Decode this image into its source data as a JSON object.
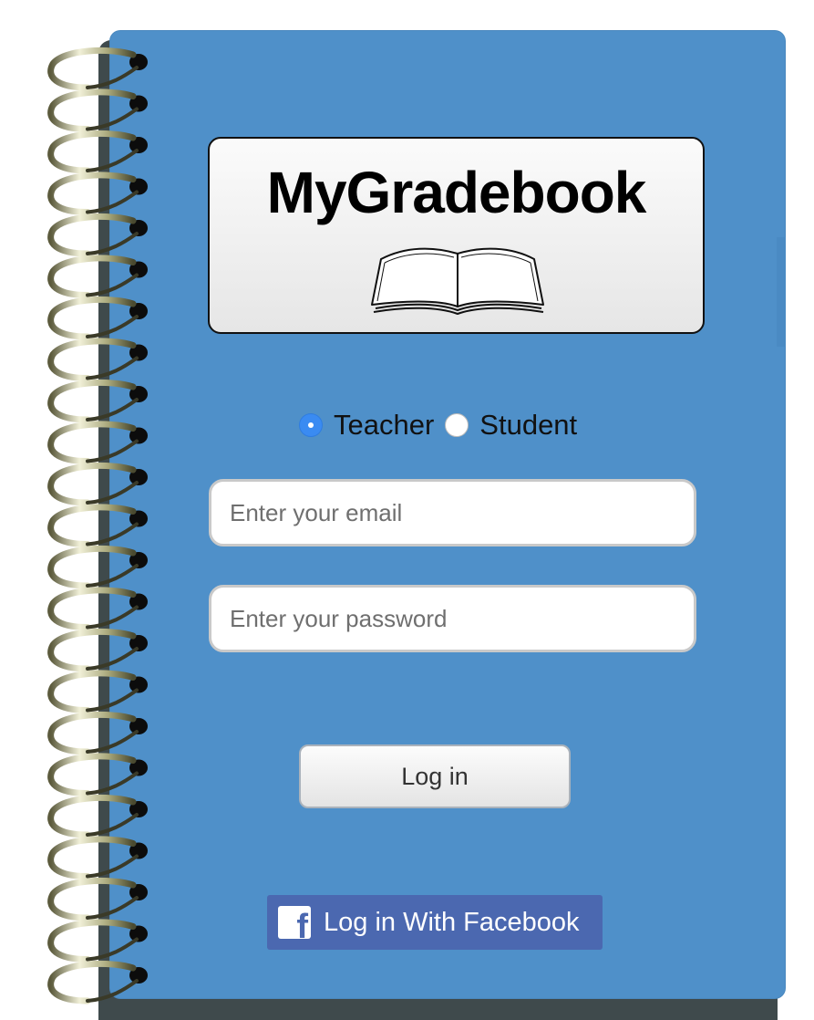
{
  "app": {
    "title": "MyGradebook"
  },
  "role": {
    "options": [
      {
        "label": "Teacher",
        "selected": true
      },
      {
        "label": "Student",
        "selected": false
      }
    ]
  },
  "login_form": {
    "email_placeholder": "Enter your email",
    "password_placeholder": "Enter your password",
    "login_label": "Log in"
  },
  "facebook": {
    "label": "Log in With Facebook",
    "logo_glyph": "f",
    "color": "#4b68b0"
  },
  "theme": {
    "cover_color": "#4f90c9",
    "radio_accent": "#3a8bf2"
  },
  "icons": [
    "book-icon",
    "spiral-binding",
    "facebook-icon"
  ]
}
